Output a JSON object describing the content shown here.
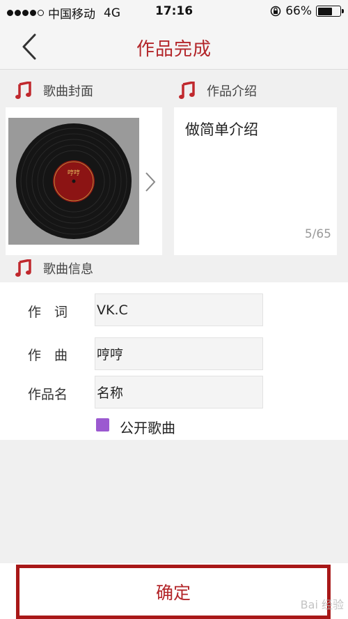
{
  "status_bar": {
    "carrier": "中国移动",
    "network": "4G",
    "time": "17:16",
    "battery_text": "66%",
    "battery_level": 0.66
  },
  "nav": {
    "title": "作品完成"
  },
  "sections": {
    "cover_label": "歌曲封面",
    "intro_label": "作品介绍",
    "info_label": "歌曲信息"
  },
  "cover": {
    "record_label_text": "哼哼"
  },
  "intro": {
    "text": "做简单介绍",
    "counter": "5/65"
  },
  "form": {
    "lyricist_label": "作　词",
    "lyricist_value": "VK.C",
    "composer_label": "作　曲",
    "composer_value": "哼哼",
    "work_name_label": "作品名",
    "work_name_value": "名称",
    "public_label": "公开歌曲"
  },
  "confirm_label": "确定",
  "watermark": "Bai 经验",
  "colors": {
    "accent": "#b3262a",
    "checkbox": "#9b59d0",
    "note_icon": "#c0282d"
  }
}
